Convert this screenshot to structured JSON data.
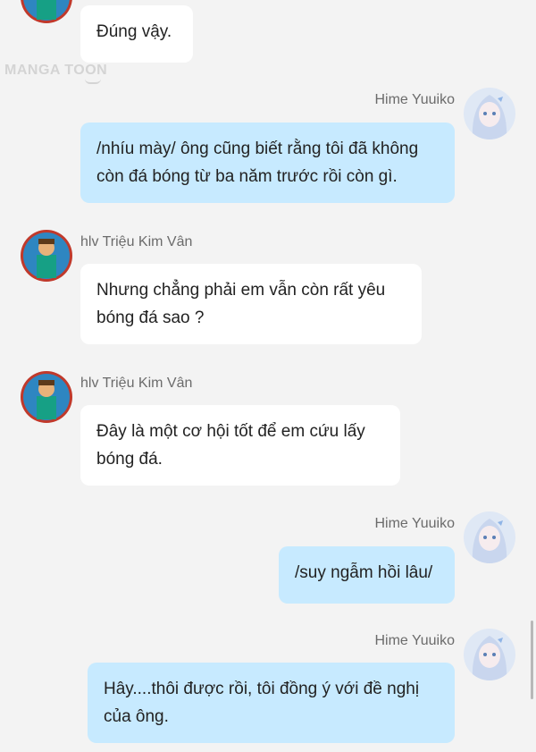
{
  "watermark": "MANGA TOON",
  "colors": {
    "page_bg": "#f3f3f3",
    "left_bubble": "#ffffff",
    "right_bubble": "#c7eaff"
  },
  "messages": [
    {
      "side": "left",
      "sender": "",
      "text": "Đúng vậy."
    },
    {
      "side": "right",
      "sender": "Hime Yuuiko",
      "lines": [
        "/nhíu mày/ ông cũng biết rằng tôi đã không",
        "còn đá bóng từ ba năm trước rồi còn gì."
      ]
    },
    {
      "side": "left",
      "sender": "hlv Triệu Kim Vân",
      "lines": [
        "Nhưng chẳng phải em vẫn còn rất yêu",
        "bóng đá sao ?"
      ]
    },
    {
      "side": "left",
      "sender": "hlv Triệu Kim Vân",
      "lines": [
        "Đây là một cơ hội tốt để em cứu lấy",
        "bóng đá."
      ]
    },
    {
      "side": "right",
      "sender": "Hime Yuuiko",
      "text": "/suy ngẫm hồi lâu/"
    },
    {
      "side": "right",
      "sender": "Hime Yuuiko",
      "lines": [
        "Hây....thôi được rồi, tôi đồng ý với đề nghị",
        "của ông."
      ]
    }
  ]
}
